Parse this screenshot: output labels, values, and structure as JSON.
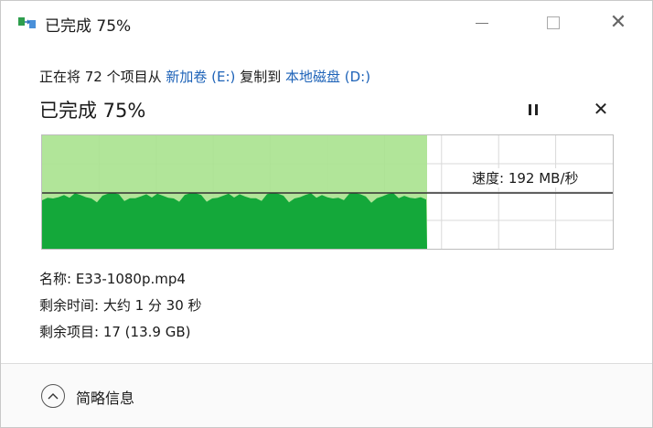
{
  "window": {
    "title": "已完成 75%",
    "icon": "copy-file-icon"
  },
  "transfer": {
    "prefix": "正在将 72 个项目从 ",
    "source": "新加卷 (E:)",
    "middle": " 复制到 ",
    "destination": "本地磁盘 (D:)",
    "progress_title": "已完成 75%",
    "progress_fraction": 0.75,
    "speed_label": "速度: 192 MB/秒"
  },
  "details": {
    "name": "名称: E33-1080p.mp4",
    "time_remaining": "剩余时间: 大约 1 分 30 秒",
    "items_remaining": "剩余项目: 17 (13.9 GB)"
  },
  "footer": {
    "collapse_label": "简略信息"
  },
  "colors": {
    "accent_fill": "#14a83a",
    "light_fill": "#a8e28e",
    "link": "#1e63b8"
  }
}
